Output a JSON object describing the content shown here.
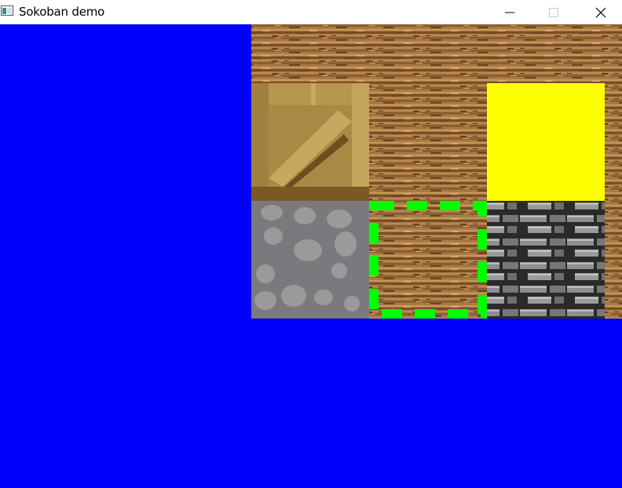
{
  "window": {
    "title": "Sokoban demo",
    "background_color": "#0000ff",
    "controls": [
      "minimize-icon",
      "maximize-icon",
      "close-icon"
    ]
  },
  "game": {
    "tile_types": {
      "floor": "wood-planks",
      "box": "wooden-crate",
      "player": "yellow-square",
      "goal": "green-dashed-outline",
      "stone": "grey-cobblestone",
      "wall": "dark-brick"
    },
    "colors": {
      "player": "#ffff00",
      "goal": "#00ff00",
      "void": "#0000ff"
    },
    "grid": [
      [
        "void",
        "void",
        "floor",
        "floor",
        "floor",
        "floor"
      ],
      [
        "void",
        "void",
        "box",
        "floor",
        "player",
        "floor"
      ],
      [
        "void",
        "void",
        "stone",
        "goal",
        "wall",
        "floor"
      ],
      [
        "void",
        "void",
        "void",
        "void",
        "void",
        "void"
      ]
    ]
  }
}
